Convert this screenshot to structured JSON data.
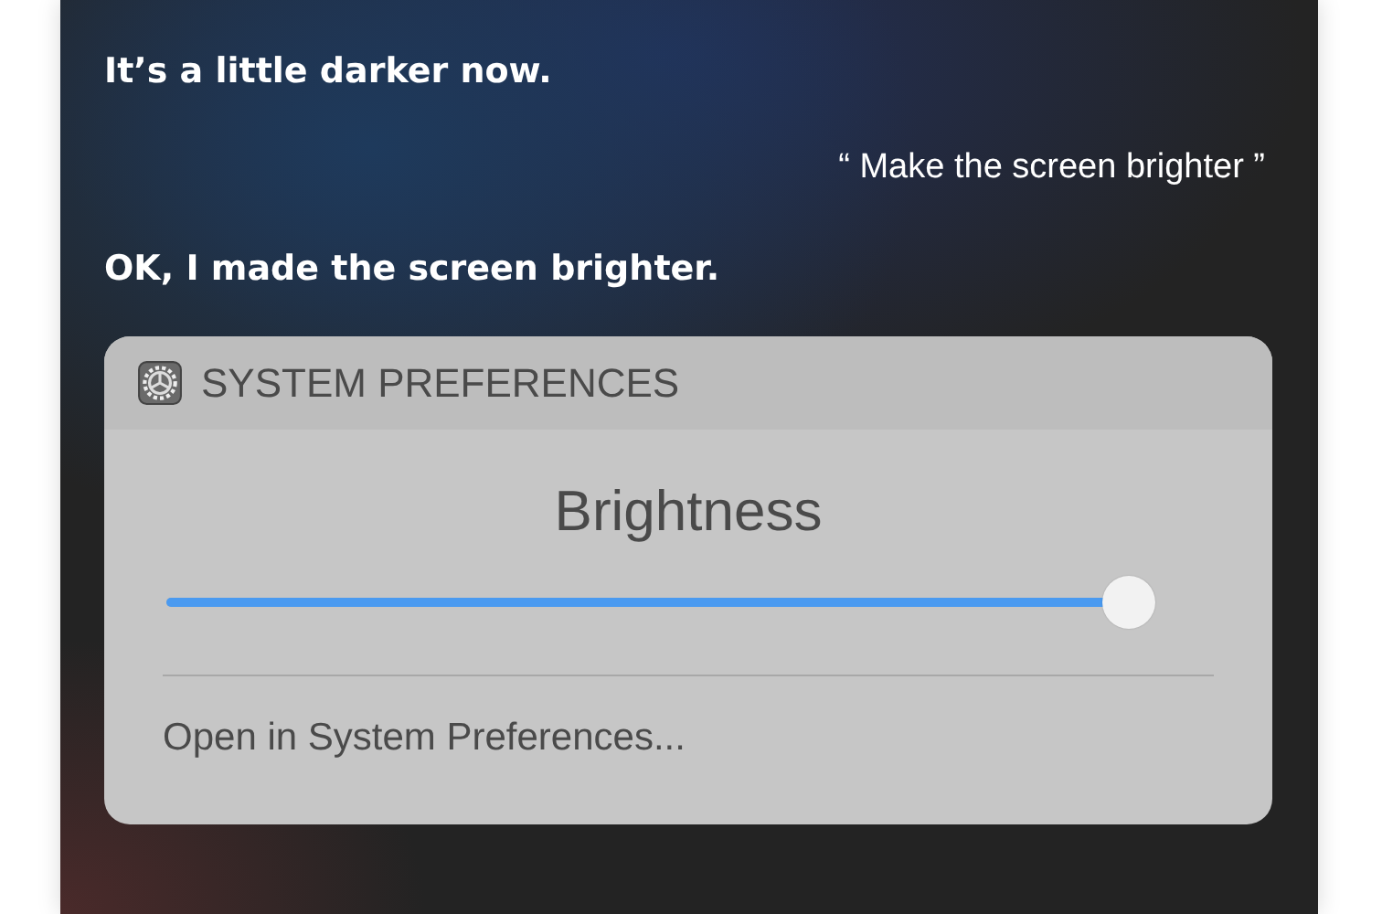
{
  "conversation": [
    {
      "kind": "reply",
      "text": "It’s a little darker now."
    },
    {
      "kind": "request",
      "text": "“ Make the screen brighter ”"
    },
    {
      "kind": "reply",
      "text": "OK, I made the screen brighter."
    }
  ],
  "card": {
    "app_title": "SYSTEM PREFERENCES",
    "setting_title": "Brightness",
    "slider": {
      "level": 1.0
    },
    "link": "Open in System Preferences..."
  }
}
